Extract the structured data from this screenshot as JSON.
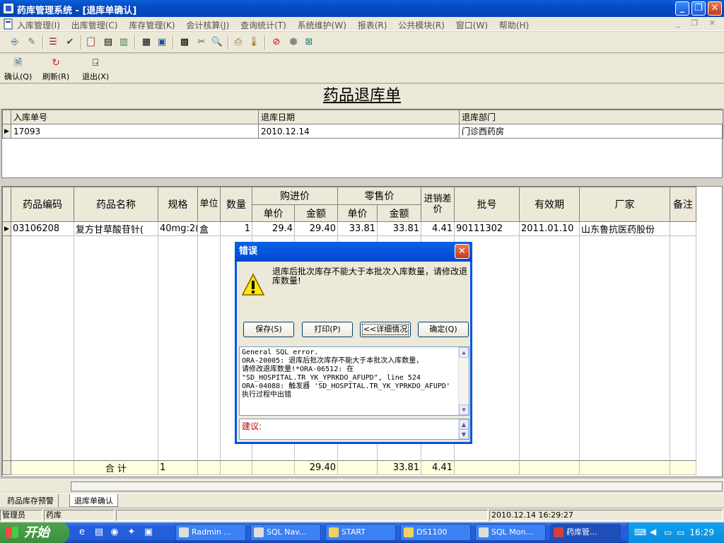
{
  "window": {
    "title": "药库管理系统 - [退库单确认]"
  },
  "menu": [
    "入库管理(I)",
    "出库管理(C)",
    "库存管理(K)",
    "会计核算(J)",
    "查询统计(T)",
    "系统维护(W)",
    "报表(R)",
    "公共模块(R)",
    "窗口(W)",
    "帮助(H)"
  ],
  "actions": {
    "confirm": "确认(Q)",
    "refresh": "刷新(R)",
    "exit": "退出(X)"
  },
  "doc_title": "药品退库单",
  "header_grid": {
    "columns": [
      "入库单号",
      "退库日期",
      "退库部门"
    ],
    "row": [
      "17093",
      "2010.12.14",
      "门诊西药房"
    ]
  },
  "detail_grid": {
    "headers": {
      "code": "药品编码",
      "name": "药品名称",
      "spec": "规格",
      "unit": "单位",
      "qty": "数量",
      "purchase": "购进价",
      "retail": "零售价",
      "unit_price": "单价",
      "amount": "金额",
      "diff": "进销差价",
      "batch": "批号",
      "expiry": "有效期",
      "maker": "厂家",
      "note": "备注"
    },
    "row": {
      "code": "03106208",
      "name": "复方甘草酸苷针(",
      "spec": "40mg:2(",
      "unit": "盒",
      "qty": "1",
      "p_price": "29.4",
      "p_amount": "29.40",
      "r_price": "33.81",
      "r_amount": "33.81",
      "diff": "4.41",
      "batch": "90111302",
      "expiry": "2011.01.10",
      "maker": "山东鲁抗医药股份",
      "note": ""
    },
    "totals": {
      "label": "合 计",
      "spec": "1",
      "p_amount": "29.40",
      "r_amount": "33.81",
      "diff": "4.41"
    }
  },
  "dialog": {
    "title": "错误",
    "message": "退库后批次库存不能大于本批次入库数量，请修改退库数量!",
    "buttons": {
      "save": "保存(S)",
      "print": "打印(P)",
      "details": "<<详细情况",
      "ok": "确定(Q)"
    },
    "error_lines": [
      "General SQL error.",
      "ORA-20005: 退库后批次库存不能大于本批次入库数量，",
      "请修改退库数量!*ORA-06512: 在",
      "\"SD_HOSPITAL.TR_YK_YPRKDO_AFUPD\", line 524",
      "ORA-04088: 触发器 'SD_HOSPITAL.TR_YK_YPRKDO_AFUPD'",
      "执行过程中出错"
    ],
    "suggest_label": "建议:"
  },
  "tabs": [
    "药品库存预警",
    "退库单确认"
  ],
  "status": {
    "user": "管理员",
    "dept": "药库",
    "datetime": "2010.12.14 16:29:27"
  },
  "taskbar": {
    "start": "开始",
    "tasks": [
      "Radmin ...",
      "SQL Nav...",
      "START",
      "DS1100",
      "SQL Mon...",
      "药库管..."
    ],
    "clock": "16:29"
  }
}
